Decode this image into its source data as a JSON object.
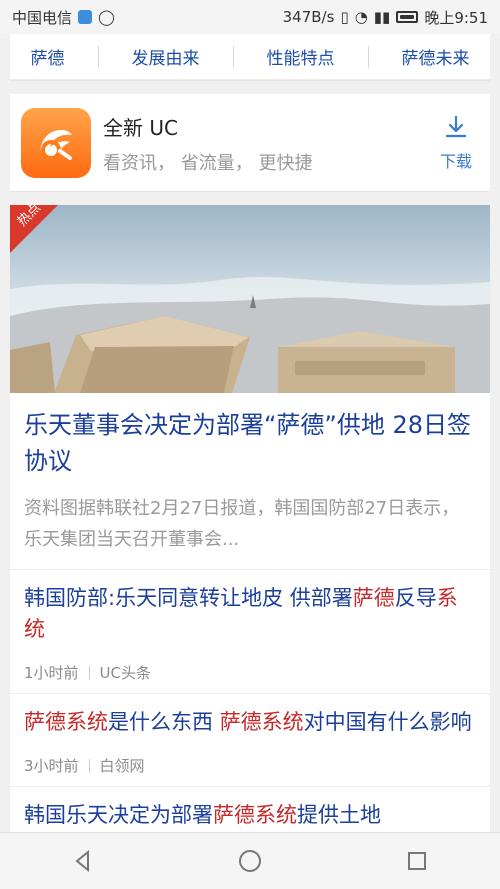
{
  "status": {
    "carrier": "中国电信",
    "network_speed": "347B/s",
    "time": "晚上9:51"
  },
  "tabs": [
    "萨德",
    "发展由来",
    "性能特点",
    "萨德未来"
  ],
  "app_promo": {
    "title": "全新 UC",
    "subtitle": "看资讯，  省流量，  更快捷",
    "download_label": "下载"
  },
  "news": {
    "hot_label": "热点",
    "featured": {
      "title": "乐天董事会决定为部署“萨德”供地 28日签协议",
      "summary": "资料图据韩联社2月27日报道，韩国国防部27日表示，乐天集团当天召开董事会..."
    },
    "items": [
      {
        "title_before": "韩国防部:乐天同意转让地皮 供部署",
        "title_highlight": "萨德",
        "title_after": "反导",
        "title_highlight2": "系统",
        "meta_time": "1小时前",
        "meta_source": "UC头条"
      },
      {
        "title_highlight": "萨德系统",
        "title_before": "是什么东西 ",
        "title_highlight2": "萨德系统",
        "title_after": "对中国有什么影响",
        "meta_time": "3小时前",
        "meta_source": "白领网"
      },
      {
        "title_before": "韩国乐天决定为部署",
        "title_highlight": "萨德系统",
        "title_after": "提供土地"
      }
    ]
  },
  "colors": {
    "link_blue": "#1b3f9b",
    "highlight_red": "#c62828",
    "uc_orange": "#ff7a1a"
  }
}
